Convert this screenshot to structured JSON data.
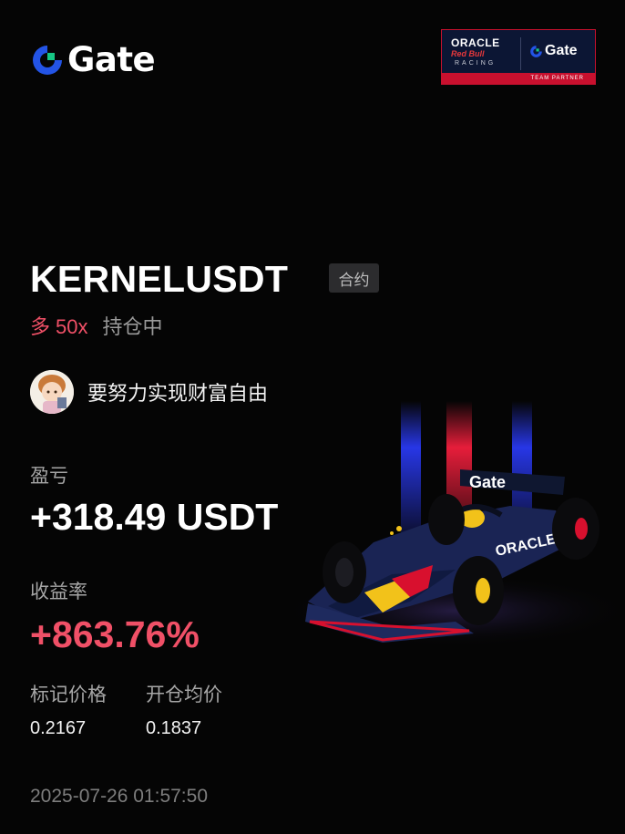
{
  "brand": {
    "name": "Gate",
    "colors": {
      "blue": "#2354e6",
      "green": "#16c784",
      "short_red": "#f05067"
    }
  },
  "partner_badge": {
    "line1": "ORACLE",
    "line2": "Red Bull",
    "line3": "RACING",
    "gate": "Gate",
    "footer": "TEAM PARTNER"
  },
  "position": {
    "symbol": "KERNELUSDT",
    "type_tag": "合约",
    "side": "多",
    "leverage": "50x",
    "status": "持仓中"
  },
  "user": {
    "name": "要努力实现财富自由"
  },
  "stats": {
    "pnl_label": "盈亏",
    "pnl_value": "+318.49 USDT",
    "roi_label": "收益率",
    "roi_value": "+863.76%",
    "mark_price_label": "标记价格",
    "mark_price": "0.2167",
    "entry_price_label": "开仓均价",
    "entry_price": "0.1837"
  },
  "timestamp": "2025-07-26 01:57:50",
  "decor": {
    "car_sponsor": "Gate",
    "car_sponsor2": "ORACLE"
  }
}
